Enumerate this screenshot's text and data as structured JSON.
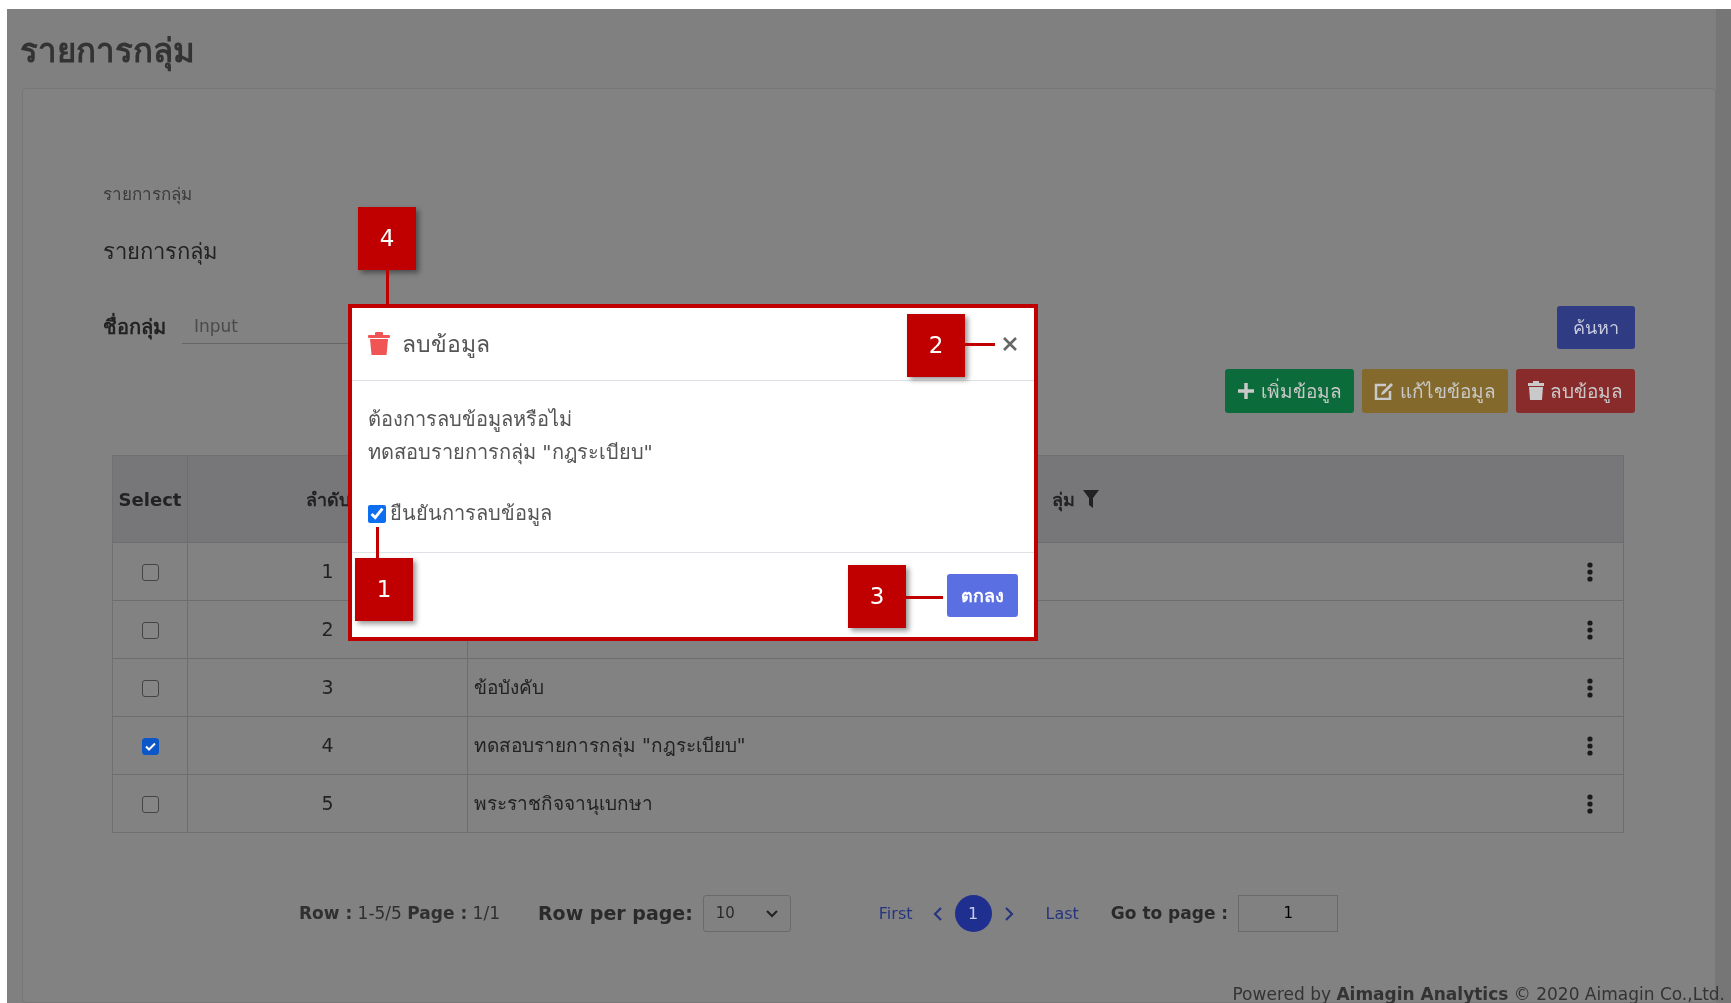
{
  "page_title": "รายการกลุ่ม",
  "breadcrumb": "รายการกลุ่ม",
  "section_title": "รายการกลุ่ม",
  "search": {
    "label": "ชื่อกลุ่ม",
    "placeholder": "Input",
    "button": "ค้นหา"
  },
  "actions": [
    {
      "kind": "add",
      "label": "เพิ่มข้อมูล"
    },
    {
      "kind": "edit",
      "label": "แก้ไขข้อมูล"
    },
    {
      "kind": "delete",
      "label": "ลบข้อมูล"
    }
  ],
  "table": {
    "columns": [
      "Select",
      "ลำดับ",
      "ลุ่ม"
    ],
    "rows": [
      {
        "checked": false,
        "number": "1"
      },
      {
        "checked": false,
        "number": "2"
      },
      {
        "checked": false,
        "number": "3",
        "name": "ข้อบังคับ"
      },
      {
        "checked": true,
        "number": "4",
        "name": "ทดสอบรายการกลุ่ม \"กฎระเบียบ\""
      },
      {
        "checked": false,
        "number": "5",
        "name": "พระราชกิจจานุเบกษา"
      }
    ]
  },
  "pagination": {
    "summary": "**Row :** 1-5/5 **Page :** 1/1",
    "per_page_label": "Row per page:",
    "per_page": "10",
    "first": "First",
    "pages": [
      {
        "label": "1",
        "selected": true
      }
    ],
    "last": "Last",
    "goto_label": "Go to page :",
    "goto_value": "1"
  },
  "footer": "Powered by **Aimagin Analytics** © 2020 Aimagin Co.,Ltd.",
  "modal": {
    "title": "ลบข้อมูล",
    "message": [
      "ต้องการลบข้อมูลหรือไม่",
      "ทดสอบรายการกลุ่ม \"กฎระเบียบ\""
    ],
    "confirm": {
      "label": "ยืนยันการลบข้อมูล",
      "checked": true
    },
    "ok": "ตกลง"
  },
  "callouts": [
    {
      "label": "4"
    },
    {
      "label": "2"
    },
    {
      "label": "1"
    },
    {
      "label": "3"
    }
  ]
}
